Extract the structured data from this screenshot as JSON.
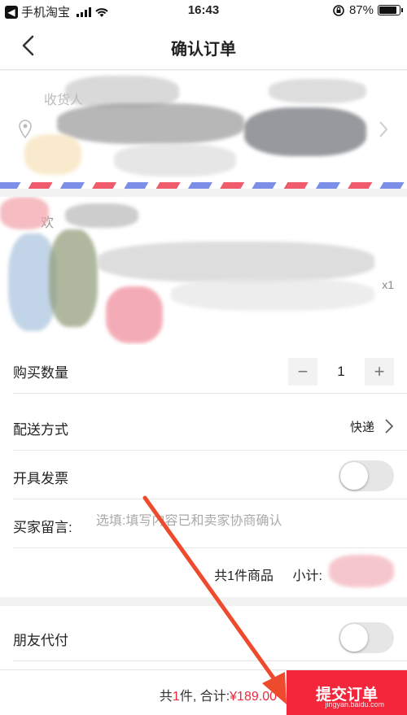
{
  "status_bar": {
    "app_name": "手机淘宝",
    "time": "16:43",
    "battery_percent": "87%",
    "battery_level": 0.87
  },
  "nav": {
    "title": "确认订单"
  },
  "address": {
    "recipient_label": "收货人"
  },
  "product": {
    "shop_name": "欢",
    "quantity_label": "x1"
  },
  "form": {
    "quantity": {
      "label": "购买数量",
      "minus": "−",
      "value": "1",
      "plus": "+"
    },
    "delivery": {
      "label": "配送方式",
      "value": "快递"
    },
    "invoice": {
      "label": "开具发票",
      "on": false
    },
    "message": {
      "label": "买家留言:",
      "placeholder": "选填:填写内容已和卖家协商确认"
    },
    "subtotal": {
      "count_text": "共1件商品",
      "label": "小计:"
    }
  },
  "friend_pay": {
    "label": "朋友代付",
    "on": false
  },
  "bottom_bar": {
    "prefix": "共",
    "count": "1",
    "middle": "件, 合计:",
    "price": "¥189.00",
    "submit_label": "提交订单"
  },
  "watermark": "jingyan.baidu.com",
  "colors": {
    "accent": "#f2273b",
    "annotation_arrow": "#ee4a2e"
  }
}
